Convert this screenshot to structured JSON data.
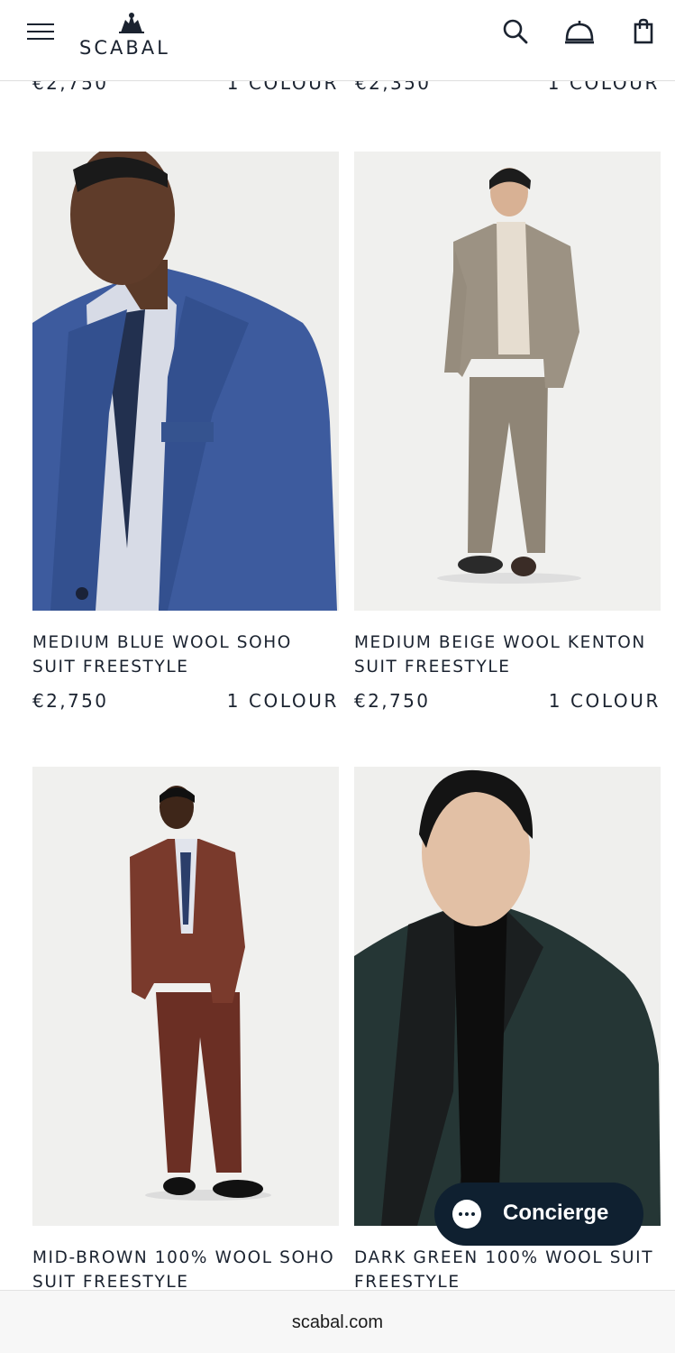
{
  "header": {
    "brand": "SCABAL",
    "icons": [
      "menu-icon",
      "search-icon",
      "concierge-bell-icon",
      "shopping-bag-icon"
    ]
  },
  "previous_row": [
    {
      "price": "€2,750",
      "colours": "1 COLOUR"
    },
    {
      "price": "€2,350",
      "colours": "1 COLOUR"
    }
  ],
  "products": [
    {
      "name": "MEDIUM BLUE WOOL SOHO SUIT FREESTYLE",
      "price": "€2,750",
      "colours": "1 COLOUR",
      "image": "man-in-blue-suit-jacket"
    },
    {
      "name": "MEDIUM BEIGE WOOL KENTON SUIT FREESTYLE",
      "price": "€2,750",
      "colours": "1 COLOUR",
      "image": "man-in-beige-suit"
    },
    {
      "name": "MID-BROWN 100% WOOL SOHO SUIT FREESTYLE",
      "image": "man-in-brown-suit"
    },
    {
      "name": "DARK GREEN 100% WOOL SUIT FREESTYLE",
      "image": "man-in-dark-green-tuxedo-jacket"
    }
  ],
  "concierge": {
    "label": "Concierge"
  },
  "browser": {
    "url": "scabal.com"
  },
  "colors": {
    "navy": "#1b2330",
    "concierge_bg": "#0f2030",
    "image_bg": "#efefed"
  }
}
